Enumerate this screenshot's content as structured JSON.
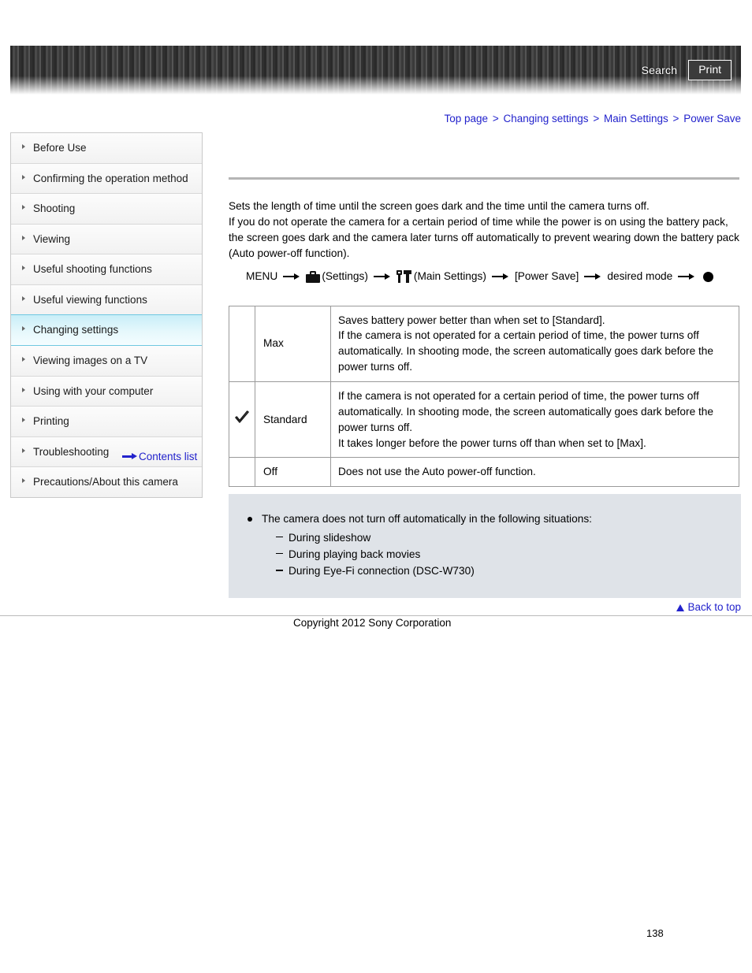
{
  "banner": {
    "search_label": "Search",
    "print_label": "Print"
  },
  "breadcrumb": {
    "items": [
      "Top page",
      "Changing settings",
      "Main Settings",
      "Power Save"
    ],
    "separator": ">"
  },
  "sidebar": {
    "items": [
      {
        "label": "Before Use",
        "active": false
      },
      {
        "label": "Confirming the operation method",
        "active": false
      },
      {
        "label": "Shooting",
        "active": false
      },
      {
        "label": "Viewing",
        "active": false
      },
      {
        "label": "Useful shooting functions",
        "active": false
      },
      {
        "label": "Useful viewing functions",
        "active": false
      },
      {
        "label": "Changing settings",
        "active": true
      },
      {
        "label": "Viewing images on a TV",
        "active": false
      },
      {
        "label": "Using with your computer",
        "active": false
      },
      {
        "label": "Printing",
        "active": false
      },
      {
        "label": "Troubleshooting",
        "active": false
      },
      {
        "label": "Precautions/About this camera",
        "active": false
      }
    ],
    "contents_list_label": "Contents list"
  },
  "main": {
    "description_lines": [
      "Sets the length of time until the screen goes dark and the time until the camera turns off.",
      "If you do not operate the camera for a certain period of time while the power is on using the battery pack, the screen goes dark and the camera later turns off automatically to prevent wearing down the battery pack (Auto power-off function)."
    ],
    "menu_path": {
      "start": "MENU",
      "settings_label": "(Settings)",
      "main_settings_label": "(Main Settings)",
      "item_label": "[Power Save]",
      "mode_label": "desired mode"
    },
    "table": {
      "rows": [
        {
          "checked": false,
          "name": "Max",
          "description": "Saves battery power better than when set to [Standard].\nIf the camera is not operated for a certain period of time, the power turns off automatically. In shooting mode, the screen automatically goes dark before the power turns off."
        },
        {
          "checked": true,
          "name": "Standard",
          "description": "If the camera is not operated for a certain period of time, the power turns off automatically. In shooting mode, the screen automatically goes dark before the power turns off.\nIt takes longer before the power turns off than when set to [Max]."
        },
        {
          "checked": false,
          "name": "Off",
          "description": "Does not use the Auto power-off function."
        }
      ]
    },
    "note": {
      "heading": "The camera does not turn off automatically in the following situations:",
      "items": [
        "During slideshow",
        "During playing back movies",
        "During Eye-Fi connection (DSC-W730)"
      ]
    }
  },
  "footer": {
    "back_to_top_label": "Back to top",
    "copyright": "Copyright 2012 Sony Corporation",
    "page_number": "138"
  }
}
